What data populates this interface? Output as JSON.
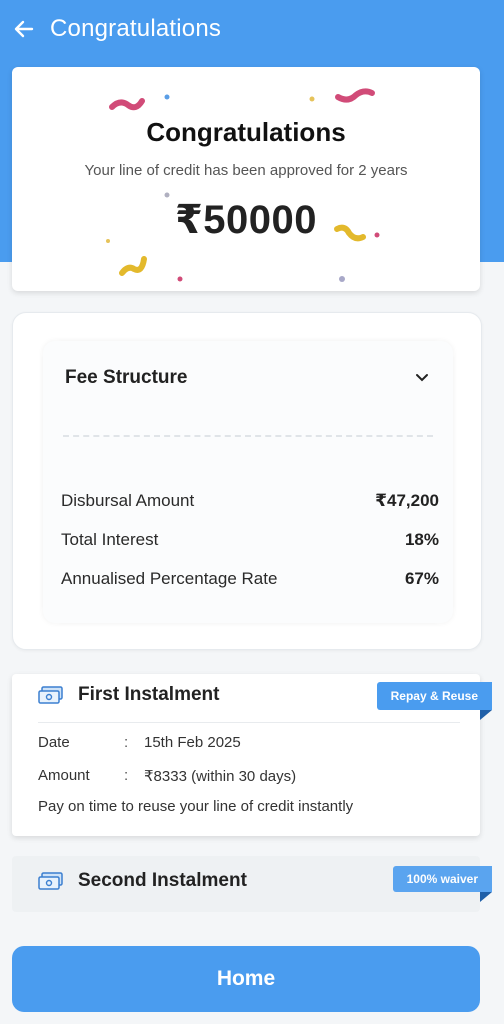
{
  "app_bar": {
    "title": "Congratulations",
    "back_icon": "arrow-left-icon"
  },
  "hero": {
    "title": "Congratulations",
    "subtitle": "Your line of credit has been approved for 2 years",
    "amount": "₹50000"
  },
  "fee": {
    "title": "Fee Structure",
    "rows": [
      {
        "label": "Disbursal Amount",
        "value": "₹47,200"
      },
      {
        "label": "Total Interest",
        "value": "18%"
      },
      {
        "label": "Annualised Percentage Rate",
        "value": "67%"
      }
    ]
  },
  "first_instalment": {
    "title": "First Instalment",
    "ribbon": "Repay & Reuse",
    "date_label": "Date",
    "date_value": "15th Feb 2025",
    "amount_label": "Amount",
    "amount_value": "₹8333 (within 30 days)",
    "note": "Pay on time to reuse your line of credit instantly"
  },
  "second_instalment": {
    "title": "Second Instalment",
    "ribbon": "100% waiver"
  },
  "home_button": {
    "label": "Home"
  },
  "colors": {
    "primary": "#4a9cef",
    "ribbon_fold": "#1f5fa8",
    "background": "#f4f6f8"
  }
}
